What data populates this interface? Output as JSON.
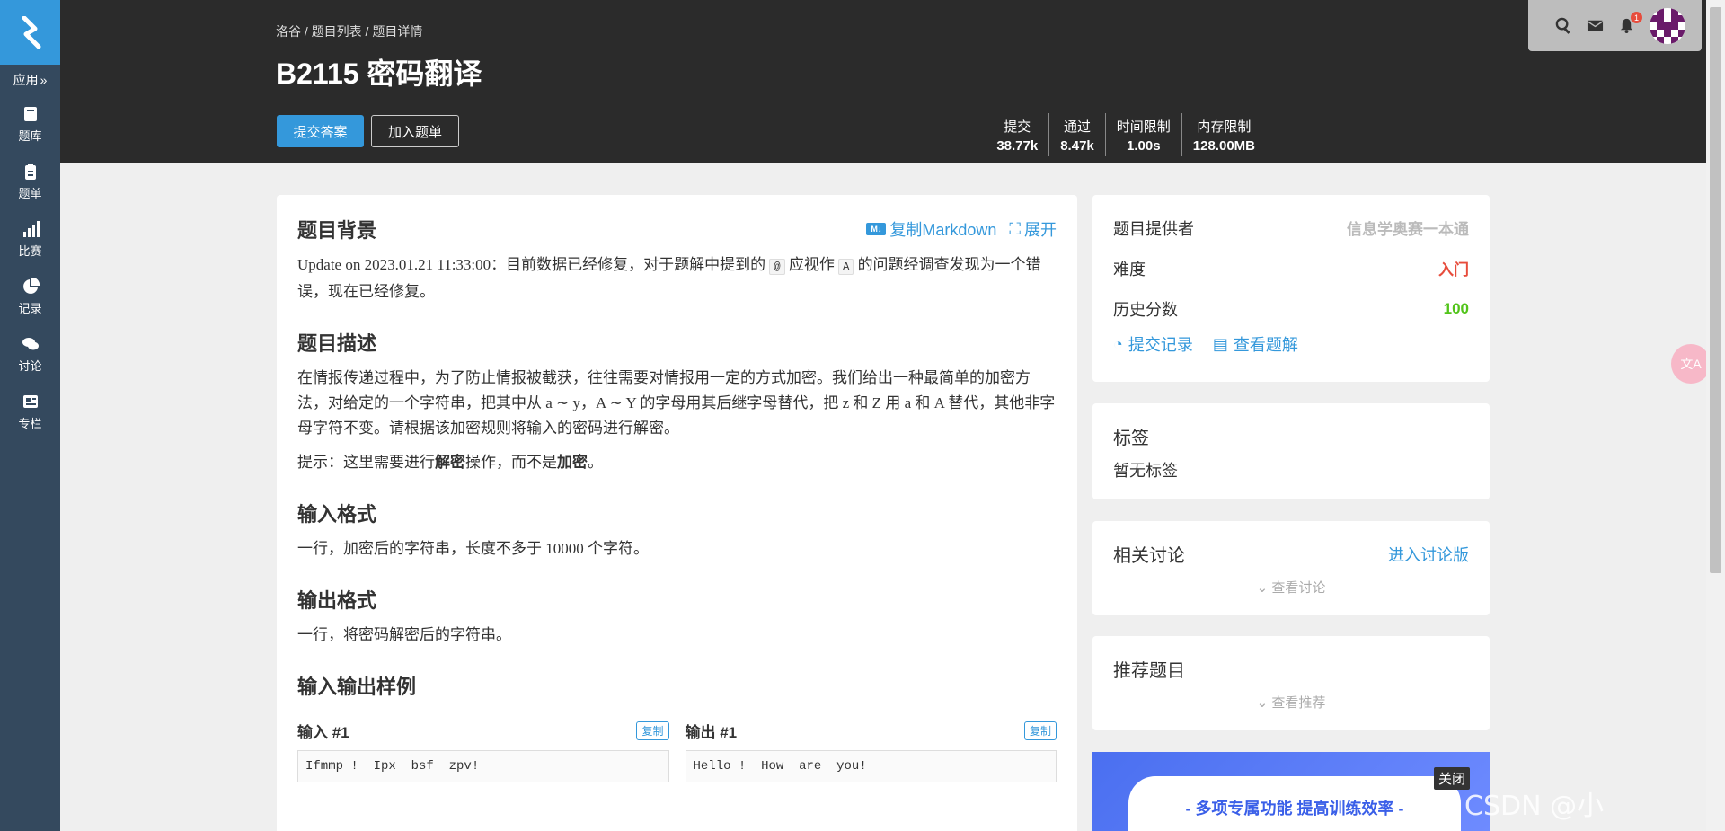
{
  "sidebar": {
    "app_label": "应用",
    "items": [
      {
        "label": "题库",
        "icon": "book-icon"
      },
      {
        "label": "题单",
        "icon": "clipboard-icon"
      },
      {
        "label": "比赛",
        "icon": "bar-chart-icon"
      },
      {
        "label": "记录",
        "icon": "pie-chart-icon"
      },
      {
        "label": "讨论",
        "icon": "chat-icon"
      },
      {
        "label": "专栏",
        "icon": "newspaper-icon"
      }
    ]
  },
  "header": {
    "breadcrumb": "洛谷 / 题目列表 / 题目详情",
    "title": "B2115 密码翻译",
    "submit_label": "提交答案",
    "add_to_list_label": "加入题单",
    "stats": [
      {
        "label": "提交",
        "value": "38.77k"
      },
      {
        "label": "通过",
        "value": "8.47k"
      },
      {
        "label": "时间限制",
        "value": "1.00s"
      },
      {
        "label": "内存限制",
        "value": "128.00MB"
      }
    ],
    "notification_count": "1"
  },
  "problem": {
    "background_title": "题目背景",
    "copy_markdown": "复制Markdown",
    "expand": "展开",
    "background_text_1": "Update on 2023.01.21 11:33:00：目前数据已经修复，对于题解中提到的 ",
    "code_at": "@",
    "background_text_2": " 应视作 ",
    "code_A": "A",
    "background_text_3": " 的问题经调查发现为一个错误，现在已经修复。",
    "description_title": "题目描述",
    "description_text": "在情报传递过程中，为了防止情报被截获，往往需要对情报用一定的方式加密。我们给出一种最简单的加密方法，对给定的一个字符串，把其中从 a ∼ y，A ∼ Y 的字母用其后继字母替代，把 z 和 Z 用 a 和 A 替代，其他非字母字符不变。请根据该加密规则将输入的密码进行解密。",
    "hint_prefix": "提示：这里需要进行",
    "hint_bold_1": "解密",
    "hint_middle": "操作，而不是",
    "hint_bold_2": "加密",
    "hint_suffix": "。",
    "input_title": "输入格式",
    "input_text": "一行，加密后的字符串，长度不多于 10000 个字符。",
    "output_title": "输出格式",
    "output_text": "一行，将密码解密后的字符串。",
    "samples_title": "输入输出样例",
    "sample_input_title": "输入 #1",
    "sample_output_title": "输出 #1",
    "copy_label": "复制",
    "sample_input": "Ifmmp !  Ipx  bsf  zpv!",
    "sample_output": "Hello !  How  are  you!"
  },
  "info": {
    "provider_label": "题目提供者",
    "provider_value": "信息学奥赛一本通",
    "difficulty_label": "难度",
    "difficulty_value": "入门",
    "score_label": "历史分数",
    "score_value": "100",
    "submissions_link": "提交记录",
    "solutions_link": "查看题解"
  },
  "tags": {
    "title": "标签",
    "empty": "暂无标签"
  },
  "discussion": {
    "title": "相关讨论",
    "link": "进入讨论版",
    "view": "查看讨论"
  },
  "recommend": {
    "title": "推荐题目",
    "view": "查看推荐"
  },
  "ad": {
    "text": "- 多项专属功能  提高训练效率 -",
    "close": "关闭"
  },
  "watermark": "CSDN @小"
}
